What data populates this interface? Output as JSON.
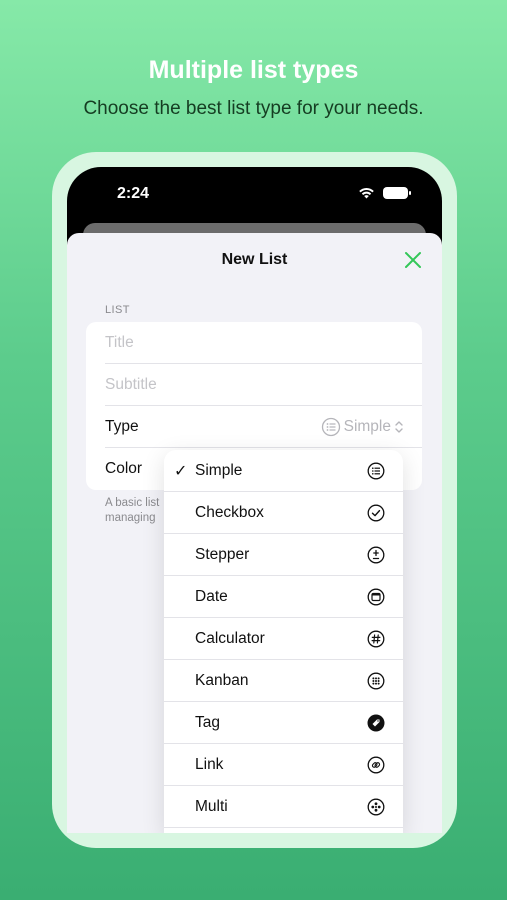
{
  "promo": {
    "headline": "Multiple list types",
    "subline": "Choose the best list type for your needs."
  },
  "status_bar": {
    "time": "2:24",
    "icons": [
      "wifi-icon",
      "battery-icon"
    ]
  },
  "sheet": {
    "title": "New List",
    "close_icon": "close-icon",
    "section_label": "LIST",
    "title_placeholder": "Title",
    "subtitle_placeholder": "Subtitle",
    "type_label": "Type",
    "type_value": "Simple",
    "color_label": "Color",
    "footnote_line1": "A basic list",
    "footnote_line2": "managing"
  },
  "type_menu": {
    "items": [
      {
        "label": "Simple",
        "icon": "list-icon",
        "selected": true
      },
      {
        "label": "Checkbox",
        "icon": "checkmark-circle-icon",
        "selected": false
      },
      {
        "label": "Stepper",
        "icon": "stepper-icon",
        "selected": false
      },
      {
        "label": "Date",
        "icon": "calendar-icon",
        "selected": false
      },
      {
        "label": "Calculator",
        "icon": "hashtag-circle-icon",
        "selected": false
      },
      {
        "label": "Kanban",
        "icon": "grid-circle-icon",
        "selected": false
      },
      {
        "label": "Tag",
        "icon": "tag-icon",
        "selected": false
      },
      {
        "label": "Link",
        "icon": "link-icon",
        "selected": false
      },
      {
        "label": "Multi",
        "icon": "multi-icon",
        "selected": false
      }
    ],
    "check_mark": "✓"
  },
  "colors": {
    "accent": "#34c759",
    "background_top": "#86e9a8",
    "background_bottom": "#3aae72"
  }
}
